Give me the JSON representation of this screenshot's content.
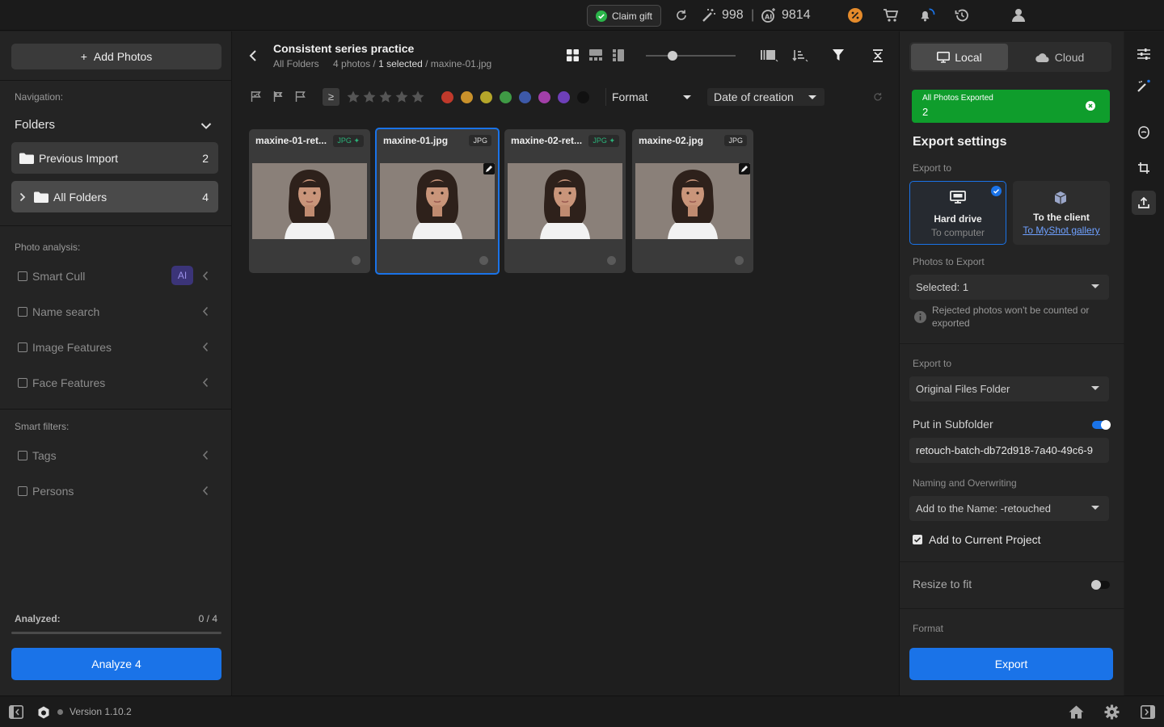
{
  "topbar": {
    "claim_gift": "Claim gift",
    "credits_magic": "998",
    "separator": "|",
    "credits_ai": "9814"
  },
  "left": {
    "add_photos": "Add Photos",
    "add_icon": "+",
    "navigation_label": "Navigation:",
    "folders_label": "Folders",
    "folders": [
      {
        "label": "Previous Import",
        "count": "2"
      },
      {
        "label": "All Folders",
        "count": "4"
      }
    ],
    "photo_analysis_label": "Photo analysis:",
    "analysis_filters": [
      {
        "label": "Smart Cull",
        "badge": "AI"
      },
      {
        "label": "Name search"
      },
      {
        "label": "Image Features"
      },
      {
        "label": "Face Features"
      }
    ],
    "smart_filters_label": "Smart filters:",
    "smart_filters": [
      {
        "label": "Tags"
      },
      {
        "label": "Persons"
      }
    ],
    "analyzed_label": "Analyzed:",
    "analyzed_value": "0 / 4",
    "analyzed_progress": 0,
    "analyze_button": "Analyze 4"
  },
  "center": {
    "project_title": "Consistent series practice",
    "breadcrumb_root": "All Folders",
    "photo_count": "4 photos /",
    "selected_text": "1 selected",
    "current_file": "/ maxine-01.jpg",
    "zoom_level": 0.3,
    "rating_operator": "≥",
    "format_dropdown": "Format",
    "sort_dropdown": "Date of creation",
    "color_labels": [
      "#c0392b",
      "#c9912b",
      "#b5a62a",
      "#3f9a45",
      "#3d59a8",
      "#a23fa8",
      "#6e3fb8",
      "#111111"
    ],
    "photos": [
      {
        "name": "maxine-01-ret...",
        "format": "JPG",
        "edited": true,
        "selected": false
      },
      {
        "name": "maxine-01.jpg",
        "format": "JPG",
        "edited": false,
        "selected": true
      },
      {
        "name": "maxine-02-ret...",
        "format": "JPG",
        "edited": true,
        "selected": false
      },
      {
        "name": "maxine-02.jpg",
        "format": "JPG",
        "edited": false,
        "selected": false
      }
    ]
  },
  "right": {
    "tab_local": "Local",
    "tab_cloud": "Cloud",
    "toast_title": "All Photos Exported",
    "toast_count": "2",
    "export_settings": "Export settings",
    "export_to_label": "Export to",
    "dest_hard_drive": "Hard drive",
    "dest_hard_drive_sub": "To computer",
    "dest_client": "To the client",
    "dest_client_link": "To MyShot gallery",
    "photos_to_export_label": "Photos to Export",
    "photos_to_export_value": "Selected: 1",
    "rejected_note": "Rejected photos won't be counted or exported",
    "export_to_label2": "Export to",
    "export_folder_value": "Original Files Folder",
    "subfolder_label": "Put in Subfolder",
    "subfolder_value": "retouch-batch-db72d918-7a40-49c6-9",
    "naming_label": "Naming and Overwriting",
    "naming_value": "Add to the Name: -retouched",
    "add_project_label": "Add to Current Project",
    "resize_label": "Resize to fit",
    "format_label": "Format",
    "export_button": "Export"
  },
  "bottom": {
    "version": "Version 1.10.2"
  },
  "colors": {
    "accent": "#1a73e8",
    "toast_green": "#0f9d2c",
    "ai_badge": "#3b3478"
  }
}
